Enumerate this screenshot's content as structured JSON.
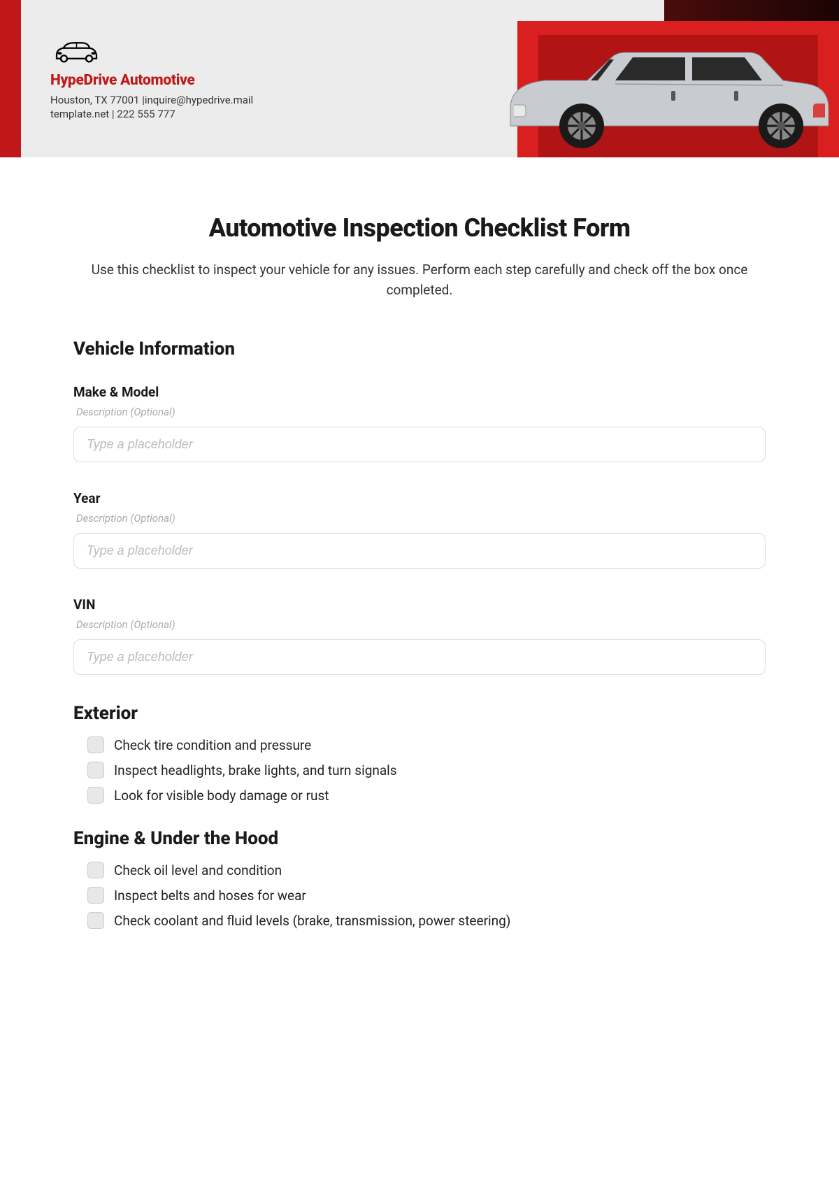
{
  "header": {
    "company_name": "HypeDrive Automotive",
    "address_line1": "Houston, TX 77001 |inquire@hypedrive.mail",
    "address_line2": "template.net | 222 555 777"
  },
  "title": "Automotive Inspection Checklist Form",
  "subtitle": "Use this checklist to inspect your vehicle for any issues. Perform each step carefully and check off the box once completed.",
  "sections": {
    "vehicle_info": {
      "heading": "Vehicle Information",
      "fields": [
        {
          "label": "Make & Model",
          "desc": "Description (Optional)",
          "placeholder": "Type a placeholder"
        },
        {
          "label": "Year",
          "desc": "Description (Optional)",
          "placeholder": "Type a placeholder"
        },
        {
          "label": "VIN",
          "desc": "Description (Optional)",
          "placeholder": "Type a placeholder"
        }
      ]
    },
    "exterior": {
      "heading": "Exterior",
      "items": [
        "Check tire condition and pressure",
        "Inspect headlights, brake lights, and turn signals",
        "Look for visible body damage or rust"
      ]
    },
    "engine": {
      "heading": "Engine & Under the Hood",
      "items": [
        "Check oil level and condition",
        "Inspect belts and hoses for wear",
        "Check coolant and fluid levels (brake, transmission, power steering)"
      ]
    }
  }
}
